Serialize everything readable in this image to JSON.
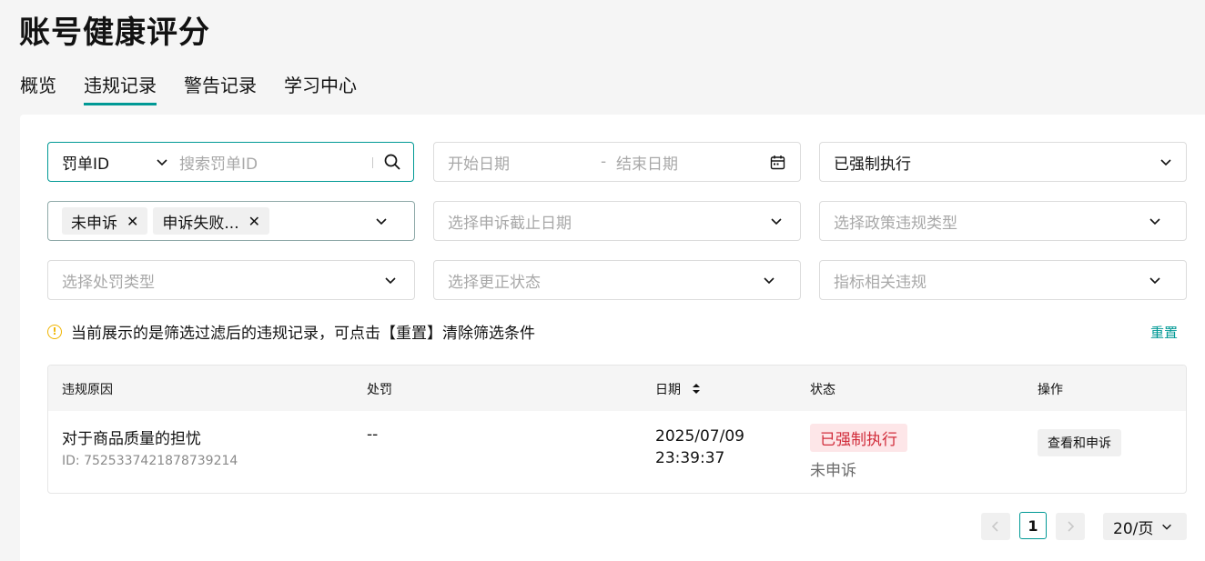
{
  "page": {
    "title": "账号健康评分"
  },
  "tabs": [
    {
      "label": "概览",
      "active": false
    },
    {
      "label": "违规记录",
      "active": true
    },
    {
      "label": "警告记录",
      "active": false
    },
    {
      "label": "学习中心",
      "active": false
    }
  ],
  "filters": {
    "search": {
      "type_label": "罚单ID",
      "placeholder": "搜索罚单ID"
    },
    "date_range": {
      "start_placeholder": "开始日期",
      "separator": "-",
      "end_placeholder": "结束日期"
    },
    "enforcement": {
      "value": "已强制执行"
    },
    "appeal_status": {
      "tags": [
        "未申诉",
        "申诉失败..."
      ]
    },
    "appeal_deadline": {
      "placeholder": "选择申诉截止日期"
    },
    "policy_type": {
      "placeholder": "选择政策违规类型"
    },
    "penalty_type": {
      "placeholder": "选择处罚类型"
    },
    "correction_status": {
      "placeholder": "选择更正状态"
    },
    "metric_related": {
      "placeholder": "指标相关违规"
    }
  },
  "notice": {
    "text": "当前展示的是筛选过滤后的违规记录，可点击【重置】清除筛选条件",
    "reset_label": "重置"
  },
  "table": {
    "columns": {
      "reason": "违规原因",
      "penalty": "处罚",
      "date": "日期",
      "status": "状态",
      "action": "操作"
    },
    "rows": [
      {
        "reason": "对于商品质量的担忧",
        "id": "ID: 7525337421878739214",
        "penalty": "--",
        "date": "2025/07/09",
        "time": "23:39:37",
        "status": "已强制执行",
        "appeal": "未申诉",
        "action": "查看和申诉"
      }
    ]
  },
  "pagination": {
    "current_page": "1",
    "page_size": "20/页"
  },
  "colors": {
    "accent": "#009995",
    "danger": "#d12d3b",
    "danger_bg": "#fde6e8",
    "warning": "#f0b400"
  }
}
